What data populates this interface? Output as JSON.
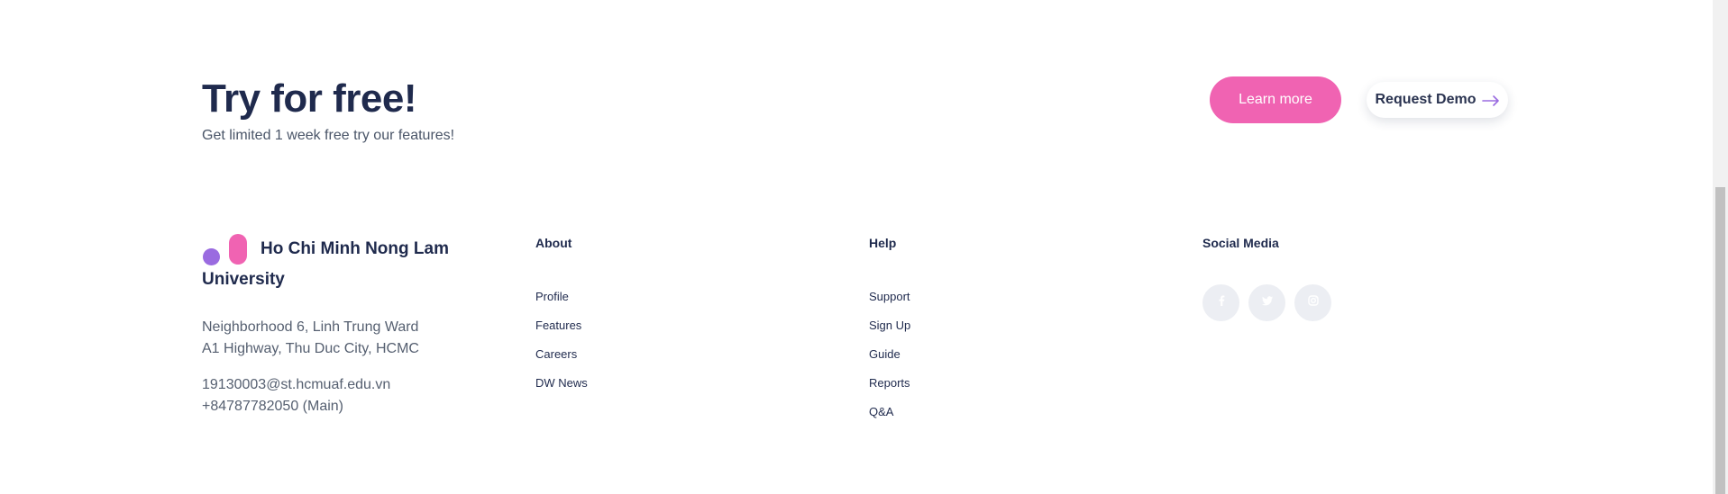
{
  "cta": {
    "title": "Try for free!",
    "subtitle": "Get limited 1 week free try our features!",
    "learn_more_label": "Learn more",
    "request_demo_label": "Request Demo"
  },
  "brand": {
    "name": "Ho Chi Minh Nong Lam University",
    "address_line1": "Neighborhood 6, Linh Trung Ward",
    "address_line2": "A1 Highway, Thu Duc City, HCMC",
    "email": "19130003@st.hcmuaf.edu.vn",
    "phone": "+84787782050 (Main)"
  },
  "footer": {
    "about": {
      "title": "About",
      "links": [
        "Profile",
        "Features",
        "Careers",
        "DW News"
      ]
    },
    "help": {
      "title": "Help",
      "links": [
        "Support",
        "Sign Up",
        "Guide",
        "Reports",
        "Q&A"
      ]
    },
    "social": {
      "title": "Social Media",
      "icons": [
        "facebook-icon",
        "twitter-icon",
        "instagram-icon"
      ]
    }
  },
  "colors": {
    "accent_pink": "#f063b2",
    "accent_purple": "#9a6be0",
    "heading": "#1f2a4d",
    "muted": "#555f70"
  }
}
